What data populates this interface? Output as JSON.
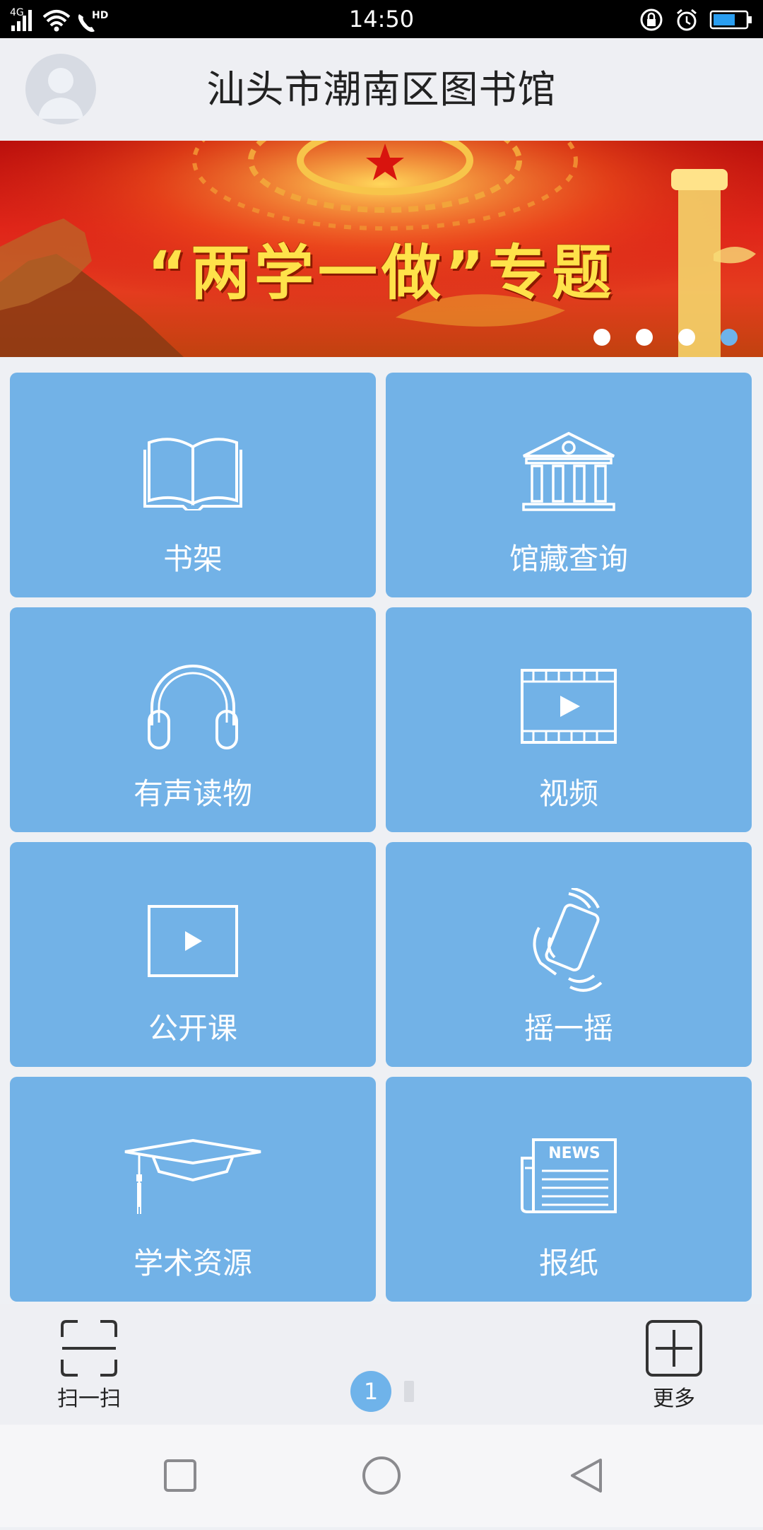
{
  "status_bar": {
    "time": "14:50",
    "network": "4G",
    "call_label": "HD"
  },
  "header": {
    "title": "汕头市潮南区图书馆"
  },
  "banner": {
    "text": "“两学一做”专题",
    "slide_count": 4,
    "active_slide": 4
  },
  "tiles": [
    {
      "label": "书架",
      "icon": "open-book-icon"
    },
    {
      "label": "馆藏查询",
      "icon": "library-building-icon"
    },
    {
      "label": "有声读物",
      "icon": "headphones-icon"
    },
    {
      "label": "视频",
      "icon": "video-film-icon"
    },
    {
      "label": "公开课",
      "icon": "play-screen-icon"
    },
    {
      "label": "摇一摇",
      "icon": "shake-phone-icon"
    },
    {
      "label": "学术资源",
      "icon": "graduation-cap-icon"
    },
    {
      "label": "报纸",
      "icon": "newspaper-icon"
    }
  ],
  "newspaper_icon_text": "NEWS",
  "bottom_bar": {
    "scan_label": "扫一扫",
    "more_label": "更多",
    "page_number": "1"
  },
  "colors": {
    "tile": "#72b2e7",
    "accent": "#6fb3ea",
    "banner_text": "#ffe24a"
  }
}
